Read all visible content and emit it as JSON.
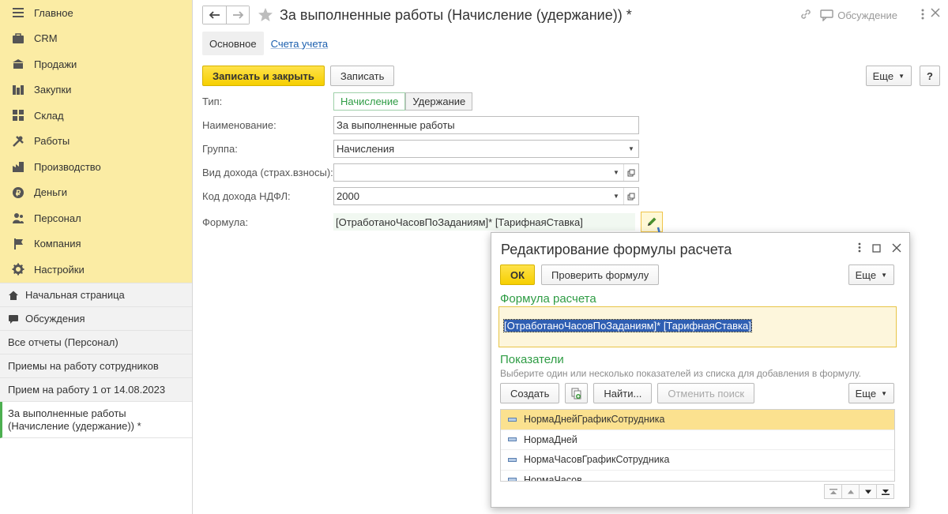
{
  "sidebar": {
    "sections": [
      {
        "label": "Главное",
        "icon": "menu-icon"
      },
      {
        "label": "CRM",
        "icon": "crm-icon"
      },
      {
        "label": "Продажи",
        "icon": "sales-icon"
      },
      {
        "label": "Закупки",
        "icon": "purchases-icon"
      },
      {
        "label": "Склад",
        "icon": "warehouse-icon"
      },
      {
        "label": "Работы",
        "icon": "works-icon"
      },
      {
        "label": "Производство",
        "icon": "production-icon"
      },
      {
        "label": "Деньги",
        "icon": "money-icon"
      },
      {
        "label": "Персонал",
        "icon": "personnel-icon"
      },
      {
        "label": "Компания",
        "icon": "company-icon"
      },
      {
        "label": "Настройки",
        "icon": "settings-icon"
      }
    ],
    "open_items": [
      {
        "label": "Начальная страница"
      },
      {
        "label": "Обсуждения"
      },
      {
        "label": "Все отчеты (Персонал)"
      },
      {
        "label": "Приемы на работу сотрудников"
      },
      {
        "label": "Прием на работу 1 от 14.08.2023"
      },
      {
        "label": "За выполненные работы (Начисление (удержание)) *"
      }
    ]
  },
  "header": {
    "title": "За выполненные работы (Начисление (удержание)) *",
    "discussion": "Обсуждение"
  },
  "tabs": [
    "Основное",
    "Счета учета"
  ],
  "toolbar": {
    "save_close": "Записать и закрыть",
    "save": "Записать",
    "more": "Еще",
    "help": "?"
  },
  "form": {
    "type_label": "Тип:",
    "type_options": [
      "Начисление",
      "Удержание"
    ],
    "name_label": "Наименование:",
    "name_value": "За выполненные работы",
    "group_label": "Группа:",
    "group_value": "Начисления",
    "income_type_label": "Вид дохода (страх.взносы):",
    "income_type_value": "",
    "ndfl_label": "Код дохода НДФЛ:",
    "ndfl_value": "2000",
    "formula_label": "Формула:",
    "formula_value": "[ОтработаноЧасовПоЗаданиям]* [ТарифнаяСтавка]"
  },
  "dialog": {
    "title": "Редактирование формулы расчета",
    "ok": "ОК",
    "check": "Проверить формулу",
    "more": "Еще",
    "formula_section": "Формула расчета",
    "formula_value": "[ОтработаноЧасовПоЗаданиям]* [ТарифнаяСтавка]",
    "indicators_section": "Показатели",
    "hint": "Выберите один или несколько показателей из списка для добавления в формулу.",
    "create": "Создать",
    "find": "Найти...",
    "cancel_search": "Отменить поиск",
    "indicators": [
      "НормаДнейГрафикСотрудника",
      "НормаДней",
      "НормаЧасовГрафикСотрудника",
      "НормаЧасов"
    ]
  },
  "colors": {
    "sidebar_bg": "#fbeca4",
    "accent_green": "#2e9c44",
    "primary_button": "#f6cf00",
    "selection_row": "#fbe18f",
    "link_blue": "#1a5eae"
  }
}
